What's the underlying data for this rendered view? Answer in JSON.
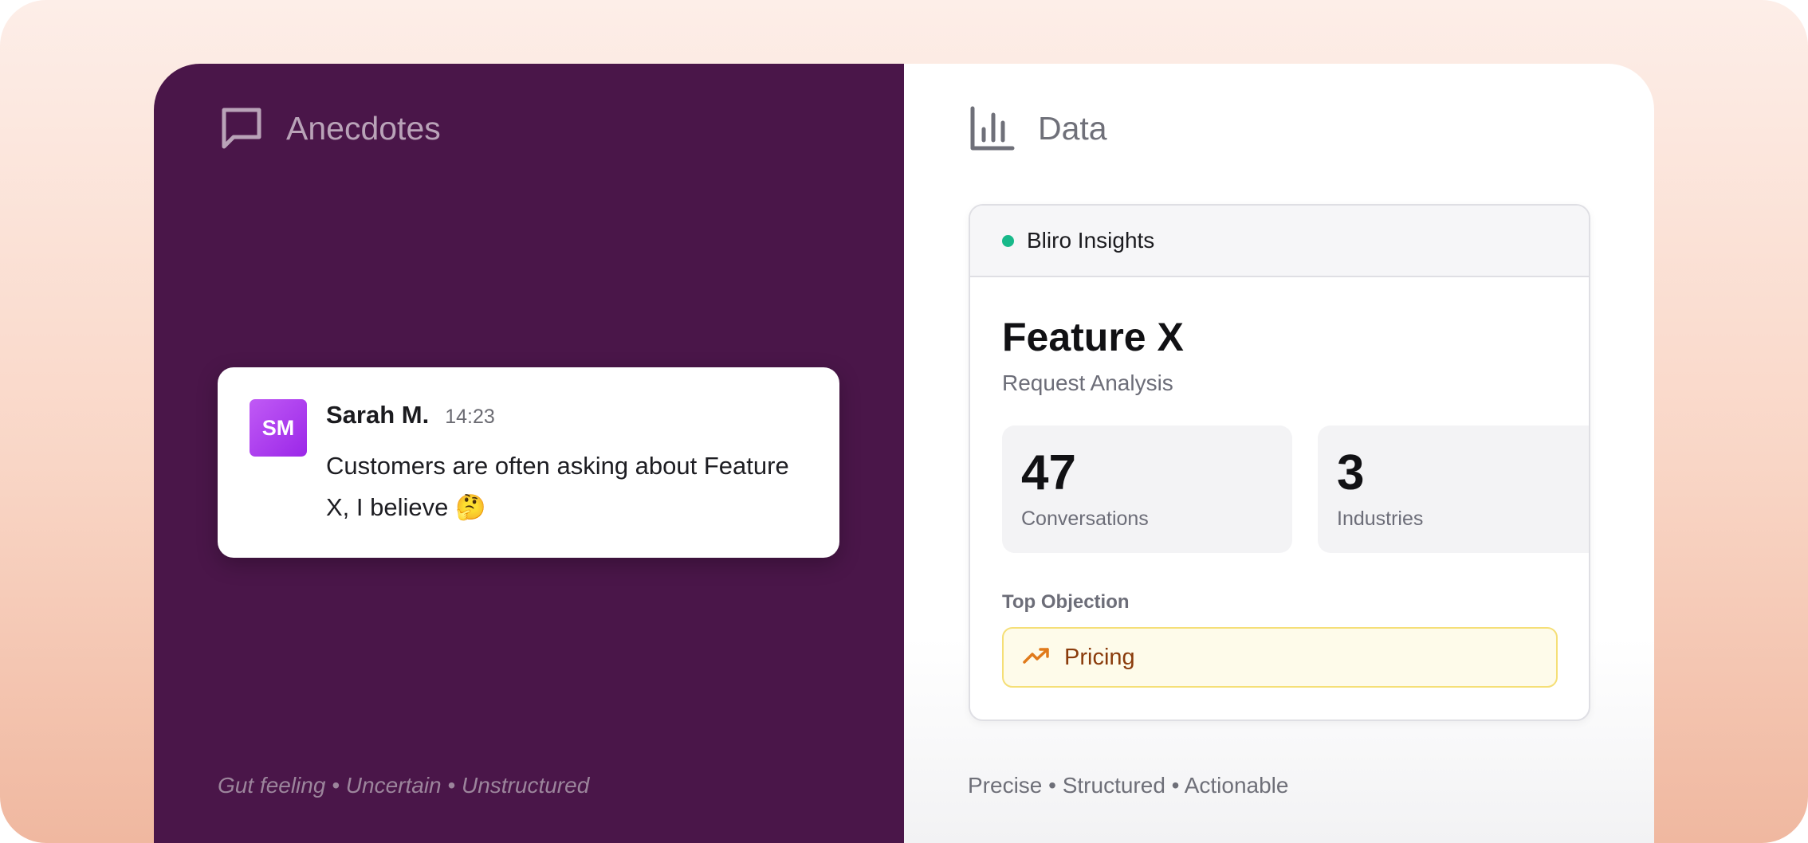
{
  "left_panel": {
    "title": "Anecdotes",
    "icon": "message-square-icon",
    "message": {
      "avatar_initials": "SM",
      "author": "Sarah M.",
      "time": "14:23",
      "text": "Customers are often asking about Feature X, I believe 🤔"
    },
    "footer": "Gut feeling • Uncertain • Unstructured"
  },
  "right_panel": {
    "title": "Data",
    "icon": "bar-chart-icon",
    "card": {
      "source": "Bliro Insights",
      "title": "Feature X",
      "subtitle": "Request Analysis",
      "stats": [
        {
          "value": "47",
          "label": "Conversations"
        },
        {
          "value": "3",
          "label": "Industries"
        }
      ],
      "objection_label": "Top Objection",
      "objection": "Pricing",
      "objection_icon": "trending-up-icon"
    },
    "footer": "Precise • Structured • Actionable"
  },
  "colors": {
    "left_bg": "#4a1649",
    "status_dot": "#18b98a",
    "avatar": "#a93ef0",
    "objection_bg": "#fefbea",
    "objection_border": "#f5df77",
    "objection_text": "#8a3b0b"
  }
}
